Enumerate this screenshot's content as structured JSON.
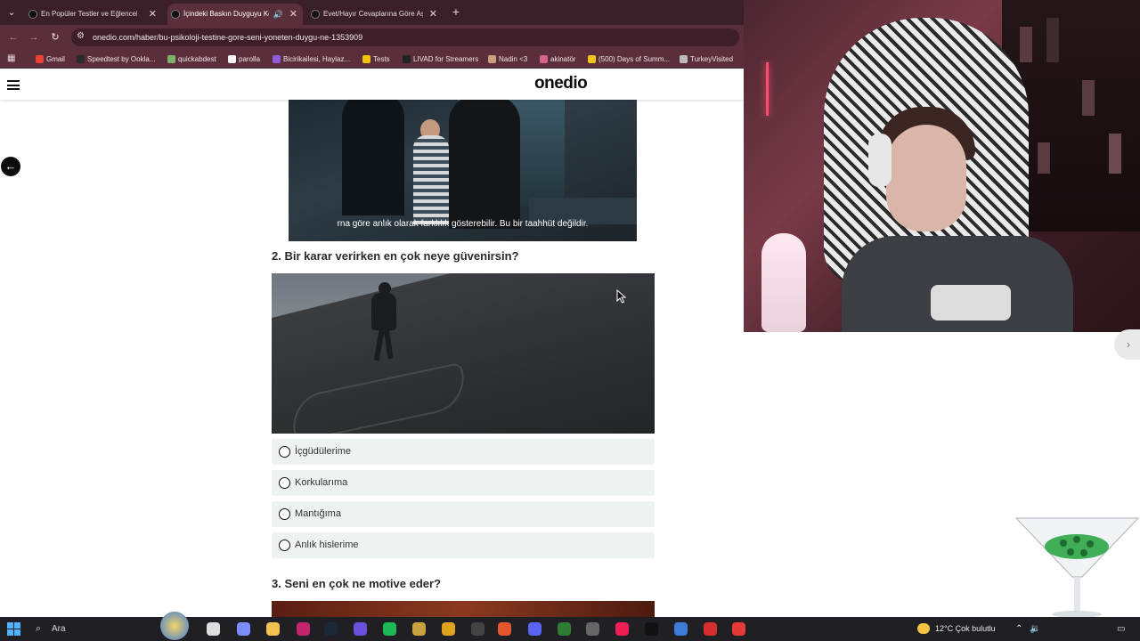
{
  "browser": {
    "tabs": [
      {
        "title": "En Popüler Testler ve Eğlenceli",
        "active": false,
        "audio": false
      },
      {
        "title": "İçindeki Baskın Duyguyu Ke",
        "active": true,
        "audio": true
      },
      {
        "title": "Evet/Hayır Cevaplarına Göre Aş",
        "active": false,
        "audio": false
      }
    ],
    "url": "onedio.com/haber/bu-psikoloji-testine-gore-seni-yoneten-duygu-ne-1353909",
    "bookmarks": [
      {
        "label": "Gmail",
        "color": "#ea4335"
      },
      {
        "label": "Speedtest by Ookla...",
        "color": "#2b2b2b"
      },
      {
        "label": "quickabdest",
        "color": "#7fb069"
      },
      {
        "label": "parolla",
        "color": "#f5f5f5"
      },
      {
        "label": "Bicirikailesi, Haylaz...",
        "color": "#8e5cd9"
      },
      {
        "label": "Tests",
        "color": "#f4c20d"
      },
      {
        "label": "LIVAD for Streamers",
        "color": "#222222"
      },
      {
        "label": "Nadin <3",
        "color": "#c99f7a"
      },
      {
        "label": "akinatör",
        "color": "#d6638b"
      },
      {
        "label": "(500) Days of Summ...",
        "color": "#f0c419"
      },
      {
        "label": "TurkeyVisited",
        "color": "#bbbbbb"
      }
    ]
  },
  "site": {
    "logo": "onedio"
  },
  "video": {
    "subtitle": "rna göre anlık olarak farklılık gösterebilir. Bu bir taahhüt değildir."
  },
  "question2": {
    "title": "2. Bir karar verirken en çok neye güvenirsin?",
    "options": [
      "İçgüdülerime",
      "Korkularıma",
      "Mantığıma",
      "Anlık hislerime"
    ]
  },
  "question3": {
    "title": "3. Seni en çok ne motive eder?"
  },
  "taskbar": {
    "search_placeholder": "Ara",
    "weather": "12°C  Çok bulutlu",
    "apps": [
      {
        "icon": "task-view-icon",
        "color": "#dddddd"
      },
      {
        "icon": "copilot-icon",
        "color": "#7b8cff"
      },
      {
        "icon": "file-explorer-icon",
        "color": "#f2c14e"
      },
      {
        "icon": "app-icon",
        "color": "#c4246b"
      },
      {
        "icon": "steam-icon",
        "color": "#1b2838"
      },
      {
        "icon": "obs-icon",
        "color": "#6a4fd8"
      },
      {
        "icon": "spotify-icon",
        "color": "#1db954"
      },
      {
        "icon": "app-icon",
        "color": "#c8a23c"
      },
      {
        "icon": "chrome-icon",
        "color": "#e0a21c"
      },
      {
        "icon": "app-icon",
        "color": "#444444"
      },
      {
        "icon": "app-icon",
        "color": "#e4572e"
      },
      {
        "icon": "discord-icon",
        "color": "#5865f2"
      },
      {
        "icon": "app-icon",
        "color": "#2e7d32"
      },
      {
        "icon": "app-icon",
        "color": "#666666"
      },
      {
        "icon": "tiktok-icon",
        "color": "#ee1d52"
      },
      {
        "icon": "tiktok-icon",
        "color": "#111111"
      },
      {
        "icon": "app-icon",
        "color": "#3d7bd6"
      },
      {
        "icon": "app-icon",
        "color": "#d32f2f"
      },
      {
        "icon": "app-icon",
        "color": "#e53935"
      }
    ]
  }
}
